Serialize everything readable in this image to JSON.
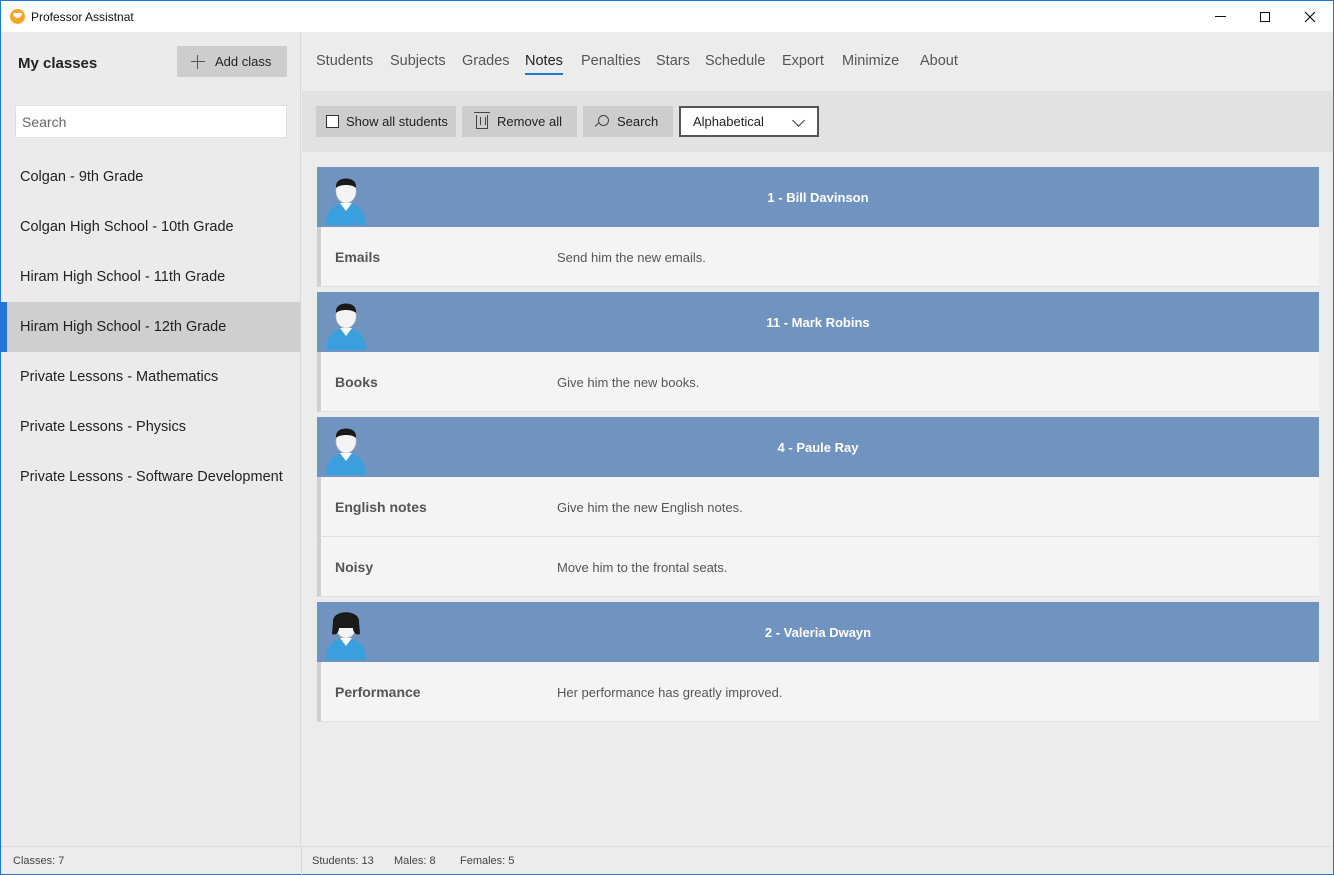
{
  "window": {
    "title": "Professor Assistnat",
    "app_icon": "graduation-cap-icon",
    "controls": [
      "minimize-icon",
      "maximize-icon",
      "close-icon"
    ]
  },
  "sidebar": {
    "heading": "My classes",
    "add_class_label": "Add class",
    "search_placeholder": "Search",
    "classes": [
      {
        "label": "Colgan - 9th Grade",
        "selected": false
      },
      {
        "label": "Colgan High School - 10th Grade",
        "selected": false
      },
      {
        "label": "Hiram High School - 11th Grade",
        "selected": false
      },
      {
        "label": "Hiram High School - 12th Grade",
        "selected": true
      },
      {
        "label": "Private Lessons - Mathematics",
        "selected": false
      },
      {
        "label": "Private Lessons - Physics",
        "selected": false
      },
      {
        "label": "Private Lessons - Software Development",
        "selected": false
      }
    ]
  },
  "nav": {
    "tabs": [
      "Students",
      "Subjects",
      "Grades",
      "Notes",
      "Penalties",
      "Stars",
      "Schedule",
      "Export",
      "Minimize",
      "About"
    ],
    "active": "Notes"
  },
  "toolbar": {
    "show_all_label": "Show all students",
    "show_all_checked": false,
    "remove_all_label": "Remove all",
    "search_label": "Search",
    "sort_value": "Alphabetical"
  },
  "students": [
    {
      "name": "1 - Bill Davinson",
      "gender": "male",
      "notes": [
        {
          "title": "Emails",
          "text": "Send him the new emails."
        }
      ]
    },
    {
      "name": "11 - Mark Robins",
      "gender": "male",
      "notes": [
        {
          "title": "Books",
          "text": "Give him the new books."
        }
      ]
    },
    {
      "name": "4 - Paule Ray",
      "gender": "male",
      "notes": [
        {
          "title": "English notes",
          "text": "Give him the new English notes."
        },
        {
          "title": "Noisy",
          "text": "Move him to the frontal seats."
        }
      ]
    },
    {
      "name": "2 - Valeria Dwayn",
      "gender": "female",
      "notes": [
        {
          "title": "Performance",
          "text": "Her performance has greatly improved."
        }
      ]
    }
  ],
  "status": {
    "classes": "Classes: 7",
    "students": "Students: 13",
    "males": "Males: 8",
    "females": "Females: 5"
  },
  "colors": {
    "accent": "#1f7ad6",
    "student_header": "#7193c0",
    "avatar_shirt": "#3aa0dd"
  }
}
